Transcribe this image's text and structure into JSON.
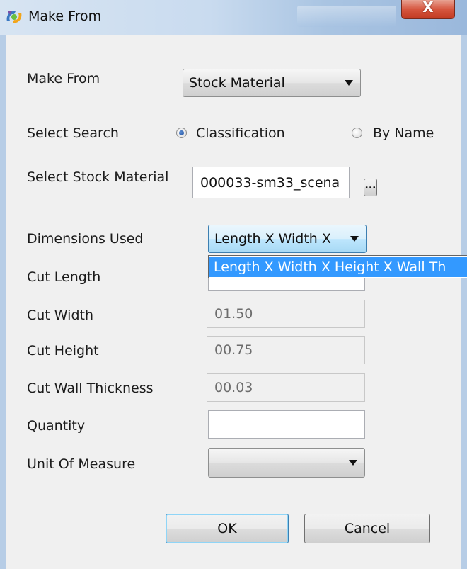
{
  "window": {
    "title": "Make From",
    "close_glyph": "X",
    "app_icon": "app-logo-icon"
  },
  "form": {
    "make_from": {
      "label": "Make From",
      "value": "Stock Material"
    },
    "select_search": {
      "label": "Select Search",
      "options": [
        {
          "label": "Classification",
          "selected": true
        },
        {
          "label": "By Name",
          "selected": false
        }
      ]
    },
    "stock_material": {
      "label": "Select Stock Material",
      "value": "000033-sm33_scena",
      "browse_label": "..."
    },
    "dimensions_used": {
      "label": "Dimensions Used",
      "value": "Length X Width X",
      "open_option": "Length X Width X Height X Wall Th"
    },
    "cut_length": {
      "label": "Cut Length",
      "value": ""
    },
    "cut_width": {
      "label": "Cut Width",
      "value": "01.50"
    },
    "cut_height": {
      "label": "Cut Height",
      "value": "00.75"
    },
    "cut_wall_thickness": {
      "label": "Cut Wall Thickness",
      "value": "00.03"
    },
    "quantity": {
      "label": "Quantity",
      "value": ""
    },
    "unit_of_measure": {
      "label": "Unit Of Measure",
      "value": ""
    }
  },
  "buttons": {
    "ok": "OK",
    "cancel": "Cancel"
  },
  "colors": {
    "selection": "#3399ff",
    "close_button": "#c23b22",
    "dialog_background": "#f0f0f0"
  }
}
